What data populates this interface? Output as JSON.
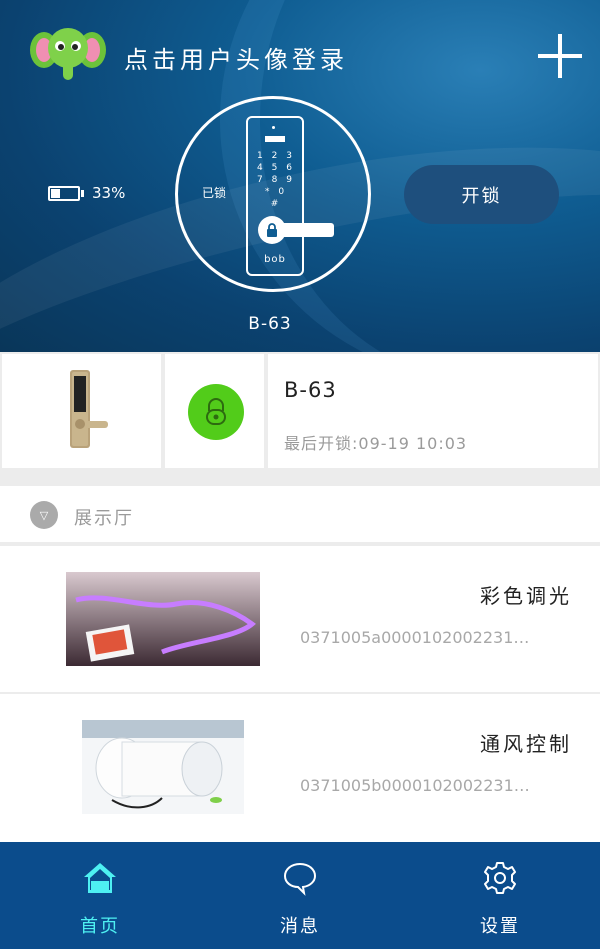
{
  "header": {
    "login_prompt": "点击用户头像登录",
    "battery_percent": "33%",
    "lock_status": "已锁",
    "keypad_rows": [
      "1 2 3",
      "4 5 6",
      "7 8 9",
      "* 0 #"
    ],
    "brand": "bob",
    "device_name": "B-63",
    "unlock_label": "开锁"
  },
  "device_card": {
    "name": "B-63",
    "last_unlock": "最后开锁:09-19 10:03"
  },
  "group": {
    "label": "展示厅"
  },
  "devices": [
    {
      "title": "彩色调光",
      "code": "0371005a0000102002231…"
    },
    {
      "title": "通风控制",
      "code": "0371005b0000102002231…"
    }
  ],
  "bottom_nav": {
    "items": [
      {
        "label": "首页",
        "icon": "home-icon",
        "active": true
      },
      {
        "label": "消息",
        "icon": "message-icon",
        "active": false
      },
      {
        "label": "设置",
        "icon": "settings-icon",
        "active": false
      }
    ]
  },
  "colors": {
    "accent_active": "#4ef0f2",
    "nav_bg": "#0b4c8c",
    "unlock_green": "#52cc1a"
  }
}
